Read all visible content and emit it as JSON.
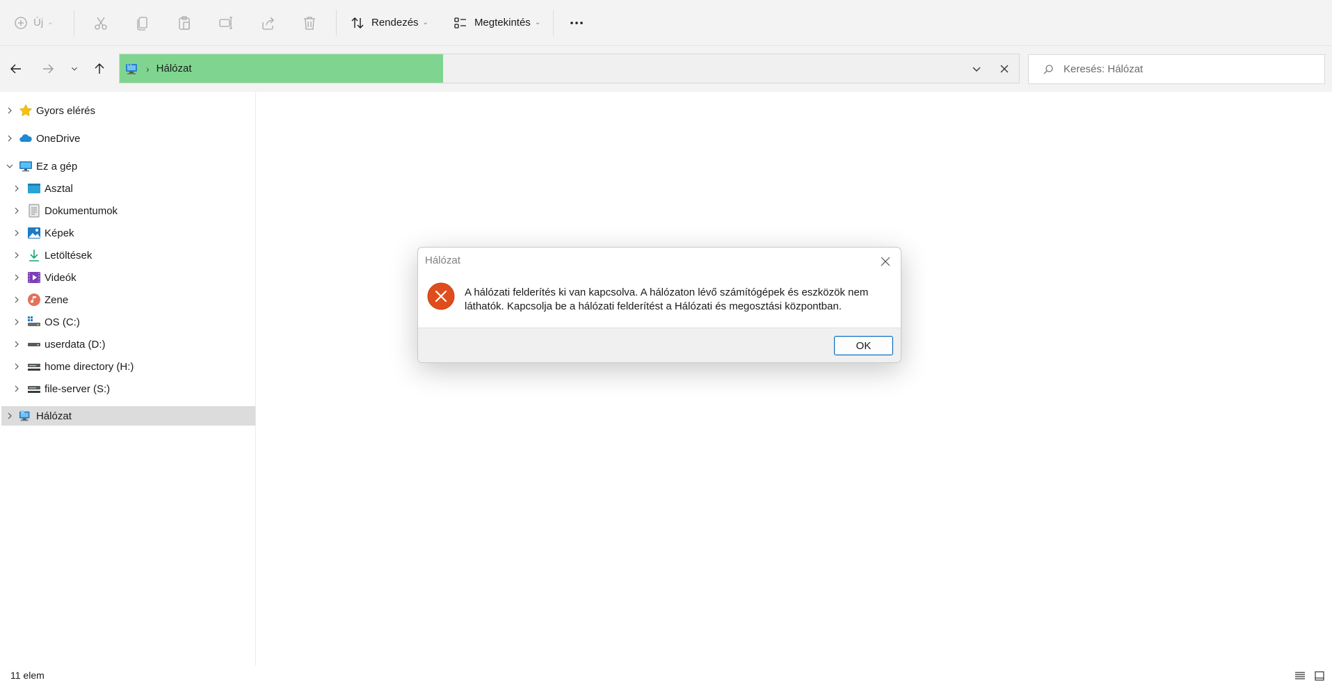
{
  "toolbar": {
    "new_label": "Új",
    "sort_label": "Rendezés",
    "view_label": "Megtekintés",
    "more_label": "···"
  },
  "address": {
    "crumb": "Hálózat",
    "progress": 0.36
  },
  "search": {
    "placeholder": "Keresés: Hálózat"
  },
  "sidebar": {
    "items": [
      {
        "label": "Gyors elérés",
        "icon": "star-icon"
      },
      {
        "label": "OneDrive",
        "icon": "cloud-icon"
      },
      {
        "label": "Ez a gép",
        "icon": "computer-icon",
        "expanded": true
      },
      {
        "label": "Asztal",
        "icon": "desktop-folder-icon"
      },
      {
        "label": "Dokumentumok",
        "icon": "documents-icon"
      },
      {
        "label": "Képek",
        "icon": "pictures-icon"
      },
      {
        "label": "Letöltések",
        "icon": "downloads-icon"
      },
      {
        "label": "Videók",
        "icon": "videos-icon"
      },
      {
        "label": "Zene",
        "icon": "music-icon"
      },
      {
        "label": "OS (C:)",
        "icon": "os-drive-icon"
      },
      {
        "label": "userdata (D:)",
        "icon": "drive-icon"
      },
      {
        "label": "home directory (H:)",
        "icon": "network-drive-icon"
      },
      {
        "label": "file-server (S:)",
        "icon": "network-drive-icon"
      },
      {
        "label": "Hálózat",
        "icon": "network-icon",
        "selected": true
      }
    ]
  },
  "dialog": {
    "title": "Hálózat",
    "message": "A hálózati felderítés ki van kapcsolva. A hálózaton lévő számítógépek és eszközök nem láthatók. Kapcsolja be a hálózati felderítést a Hálózati és megosztási központban.",
    "ok_label": "OK"
  },
  "status": {
    "item_count": "11 elem"
  },
  "colors": {
    "progress": "#7fd58f",
    "error_icon": "#e04d1c",
    "ok_border": "#0067c0"
  }
}
